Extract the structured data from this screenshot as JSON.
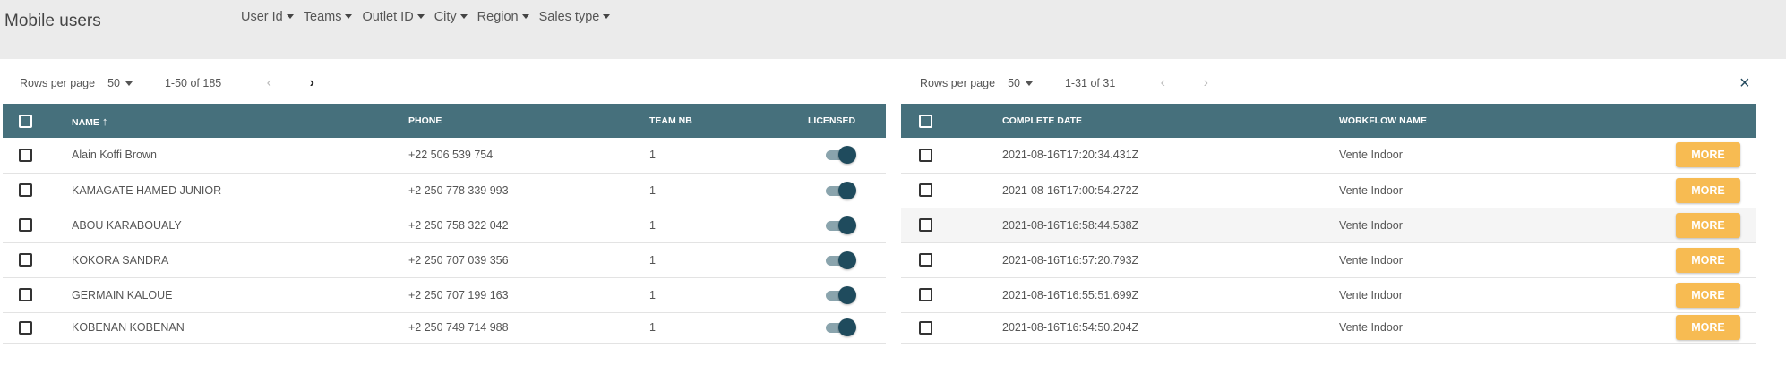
{
  "header": {
    "title": "Mobile users",
    "filters": [
      "User Id",
      "Teams",
      "Outlet ID",
      "City",
      "Region",
      "Sales type"
    ]
  },
  "users_table": {
    "pager": {
      "rows_label": "Rows per page",
      "rows_value": "50",
      "range": "1-50 of 185"
    },
    "columns": {
      "name": "NAME",
      "sort_arrow": "↑",
      "phone": "PHONE",
      "team": "TEAM NB",
      "licensed": "LICENSED"
    },
    "rows": [
      {
        "name": "Alain Koffi Brown",
        "phone": "+22 506 539 754",
        "team": "1",
        "licensed": true
      },
      {
        "name": "KAMAGATE HAMED JUNIOR",
        "phone": "+2 250 778 339 993",
        "team": "1",
        "licensed": true
      },
      {
        "name": "ABOU KARABOUALY",
        "phone": "+2 250 758 322 042",
        "team": "1",
        "licensed": true
      },
      {
        "name": "KOKORA SANDRA",
        "phone": "+2 250 707 039 356",
        "team": "1",
        "licensed": true
      },
      {
        "name": "GERMAIN KALOUE",
        "phone": "+2 250 707 199 163",
        "team": "1",
        "licensed": true
      },
      {
        "name": "KOBENAN KOBENAN",
        "phone": "+2 250 749 714 988",
        "team": "1",
        "licensed": true
      }
    ]
  },
  "workflow_table": {
    "pager": {
      "rows_label": "Rows per page",
      "rows_value": "50",
      "range": "1-31 of 31"
    },
    "close_icon": "×",
    "columns": {
      "date": "COMPLETE DATE",
      "workflow": "WORKFLOW NAME"
    },
    "more_label": "MORE",
    "rows": [
      {
        "date": "2021-08-16T17:20:34.431Z",
        "workflow": "Vente Indoor"
      },
      {
        "date": "2021-08-16T17:00:54.272Z",
        "workflow": "Vente Indoor"
      },
      {
        "date": "2021-08-16T16:58:44.538Z",
        "workflow": "Vente Indoor"
      },
      {
        "date": "2021-08-16T16:57:20.793Z",
        "workflow": "Vente Indoor"
      },
      {
        "date": "2021-08-16T16:55:51.699Z",
        "workflow": "Vente Indoor"
      },
      {
        "date": "2021-08-16T16:54:50.204Z",
        "workflow": "Vente Indoor"
      }
    ]
  },
  "colors": {
    "header_bg": "#46707c",
    "more_button": "#f7bb52",
    "toggle_knob": "#1f4b5d",
    "close_icon": "#23495d"
  },
  "icons": {
    "prev": "chevron-left-icon",
    "next": "chevron-right-icon",
    "close": "close-icon"
  }
}
